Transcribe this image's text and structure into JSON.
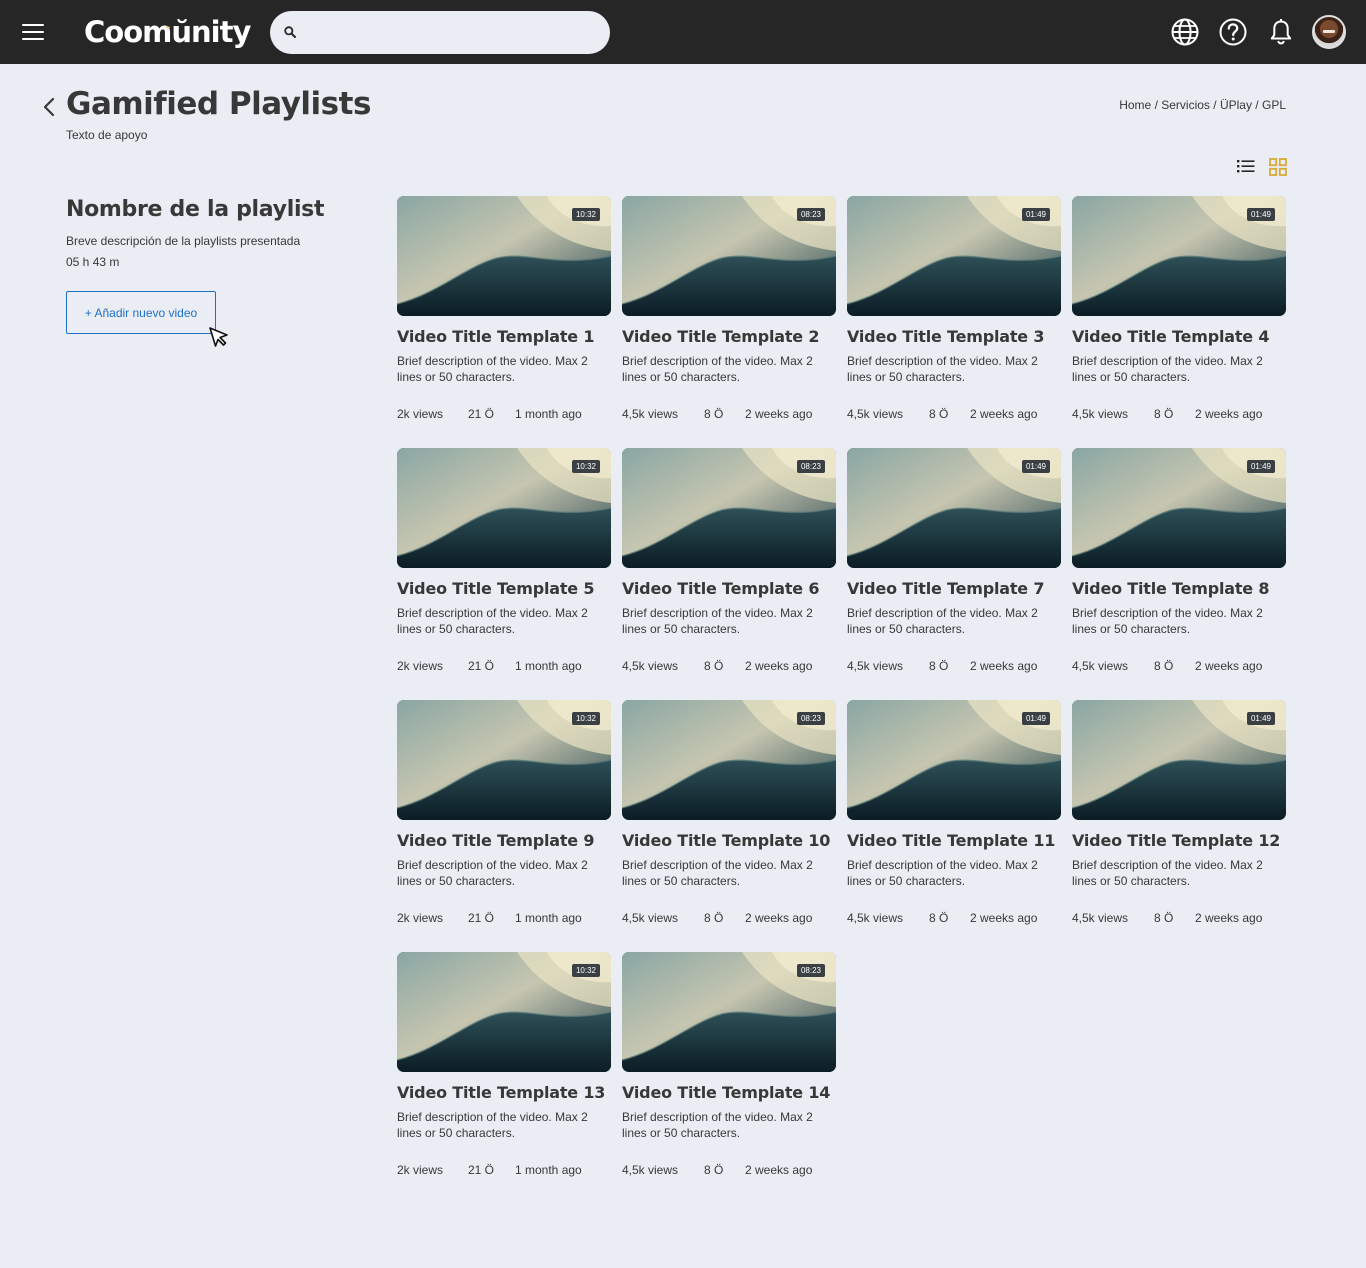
{
  "app": {
    "logo_text": "Coomŭnity",
    "logo_dots": "¨"
  },
  "search": {
    "placeholder": "",
    "value": ""
  },
  "header": {
    "title": "Gamified Playlists",
    "subtitle": "Texto de apoyo",
    "breadcrumb": [
      "Home",
      "Servicios",
      "ÜPlay",
      "GPL"
    ],
    "breadcrumb_sep": " / "
  },
  "playlist": {
    "name": "Nombre de la playlist",
    "description": "Breve descripción de la playlists presentada",
    "duration": "05 h 43 m",
    "add_button": "+ Añadir nuevo video"
  },
  "colors": {
    "topbar": "#262626",
    "background": "#eaedf4",
    "accent": "#1f71c4",
    "gold": "#e4b33b",
    "text": "#383838"
  },
  "videos": [
    {
      "title": "Video Title Template 1",
      "description": "Brief description of the video. Max 2 lines or 50 characters.",
      "duration": "10:32",
      "views": "2k views",
      "ondas": "21 Ö",
      "age": "1 month ago"
    },
    {
      "title": "Video Title Template 2",
      "description": "Brief description of the video. Max 2 lines or 50 characters.",
      "duration": "08:23",
      "views": "4,5k views",
      "ondas": "8 Ö",
      "age": "2 weeks ago"
    },
    {
      "title": "Video Title Template 3",
      "description": "Brief description of the video. Max 2 lines or 50 characters.",
      "duration": "01:49",
      "views": "4,5k views",
      "ondas": "8 Ö",
      "age": "2 weeks ago"
    },
    {
      "title": "Video Title Template 4",
      "description": "Brief description of the video. Max 2 lines or 50 characters.",
      "duration": "01:49",
      "views": "4,5k views",
      "ondas": "8 Ö",
      "age": "2 weeks ago"
    },
    {
      "title": "Video Title Template 5",
      "description": "Brief description of the video. Max 2 lines or 50 characters.",
      "duration": "10:32",
      "views": "2k views",
      "ondas": "21 Ö",
      "age": "1 month ago"
    },
    {
      "title": "Video Title Template 6",
      "description": "Brief description of the video. Max 2 lines or 50 characters.",
      "duration": "08:23",
      "views": "4,5k views",
      "ondas": "8 Ö",
      "age": "2 weeks ago"
    },
    {
      "title": "Video Title Template 7",
      "description": "Brief description of the video. Max 2 lines or 50 characters.",
      "duration": "01:49",
      "views": "4,5k views",
      "ondas": "8 Ö",
      "age": "2 weeks ago"
    },
    {
      "title": "Video Title Template 8",
      "description": "Brief description of the video. Max 2 lines or 50 characters.",
      "duration": "01:49",
      "views": "4,5k views",
      "ondas": "8 Ö",
      "age": "2 weeks ago"
    },
    {
      "title": "Video Title Template 9",
      "description": "Brief description of the video. Max 2 lines or 50 characters.",
      "duration": "10:32",
      "views": "2k views",
      "ondas": "21 Ö",
      "age": "1 month ago"
    },
    {
      "title": "Video Title Template 10",
      "description": "Brief description of the video. Max 2 lines or 50 characters.",
      "duration": "08:23",
      "views": "4,5k views",
      "ondas": "8 Ö",
      "age": "2 weeks ago"
    },
    {
      "title": "Video Title Template 11",
      "description": "Brief description of the video. Max 2 lines or 50 characters.",
      "duration": "01:49",
      "views": "4,5k views",
      "ondas": "8 Ö",
      "age": "2 weeks ago"
    },
    {
      "title": "Video Title Template 12",
      "description": "Brief description of the video. Max 2 lines or 50 characters.",
      "duration": "01:49",
      "views": "4,5k views",
      "ondas": "8 Ö",
      "age": "2 weeks ago"
    },
    {
      "title": "Video Title Template 13",
      "description": "Brief description of the video. Max 2 lines or 50 characters.",
      "duration": "10:32",
      "views": "2k views",
      "ondas": "21 Ö",
      "age": "1 month ago"
    },
    {
      "title": "Video Title Template 14",
      "description": "Brief description of the video. Max 2 lines or 50 characters.",
      "duration": "08:23",
      "views": "4,5k views",
      "ondas": "8 Ö",
      "age": "2 weeks ago"
    }
  ]
}
